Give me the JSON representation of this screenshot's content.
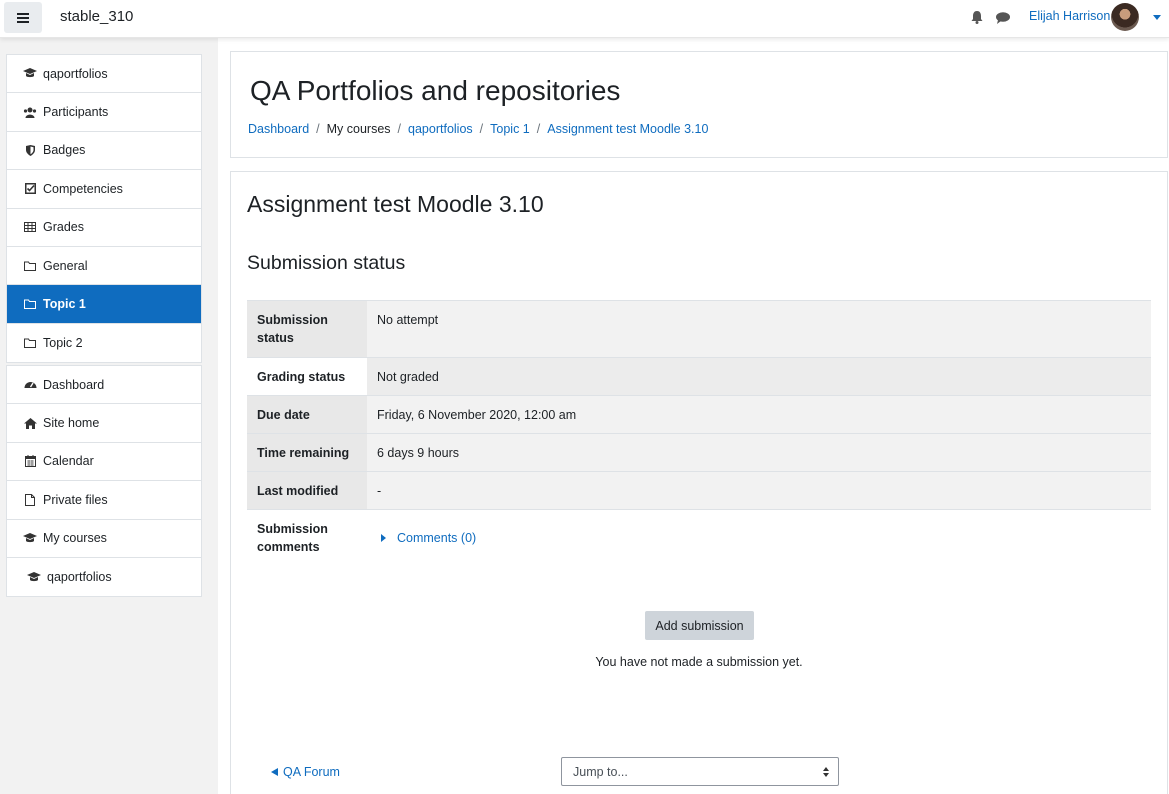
{
  "navbar": {
    "site_name": "stable_310",
    "user_name": "Elijah Harrison"
  },
  "drawer": {
    "course_items": [
      {
        "label": "qaportfolios",
        "icon": "graduation-cap-icon"
      },
      {
        "label": "Participants",
        "icon": "users-icon"
      },
      {
        "label": "Badges",
        "icon": "shield-icon"
      },
      {
        "label": "Competencies",
        "icon": "check-square-icon"
      },
      {
        "label": "Grades",
        "icon": "table-icon"
      },
      {
        "label": "General",
        "icon": "folder-icon"
      },
      {
        "label": "Topic 1",
        "icon": "folder-icon",
        "active": true
      },
      {
        "label": "Topic 2",
        "icon": "folder-icon"
      }
    ],
    "site_items": [
      {
        "label": "Dashboard",
        "icon": "tachometer-icon"
      },
      {
        "label": "Site home",
        "icon": "home-icon"
      },
      {
        "label": "Calendar",
        "icon": "calendar-icon"
      },
      {
        "label": "Private files",
        "icon": "file-icon"
      },
      {
        "label": "My courses",
        "icon": "graduation-cap-icon"
      },
      {
        "label": "qaportfolios",
        "icon": "graduation-cap-icon"
      }
    ]
  },
  "header": {
    "title": "QA Portfolios and repositories",
    "breadcrumb": [
      "Dashboard",
      "My courses",
      "qaportfolios",
      "Topic 1",
      "Assignment test Moodle 3.10"
    ]
  },
  "main": {
    "assignment_title": "Assignment test Moodle 3.10",
    "section_title": "Submission status",
    "rows": [
      {
        "label_line1": "Submission",
        "label_line2": "status",
        "value": "No attempt"
      },
      {
        "label": "Grading status",
        "value": "Not graded"
      },
      {
        "label": "Due date",
        "value": "Friday, 6 November 2020, 12:00 am"
      },
      {
        "label": "Time remaining",
        "value": "6 days 9 hours"
      },
      {
        "label": "Last modified",
        "value": "-"
      },
      {
        "label_line1": "Submission",
        "label_line2": "comments",
        "value": "Comments (0)"
      }
    ],
    "add_submission_label": "Add submission",
    "no_submission_text": "You have not made a submission yet.",
    "prev_link": "QA Forum",
    "jump_to": "Jump to..."
  }
}
